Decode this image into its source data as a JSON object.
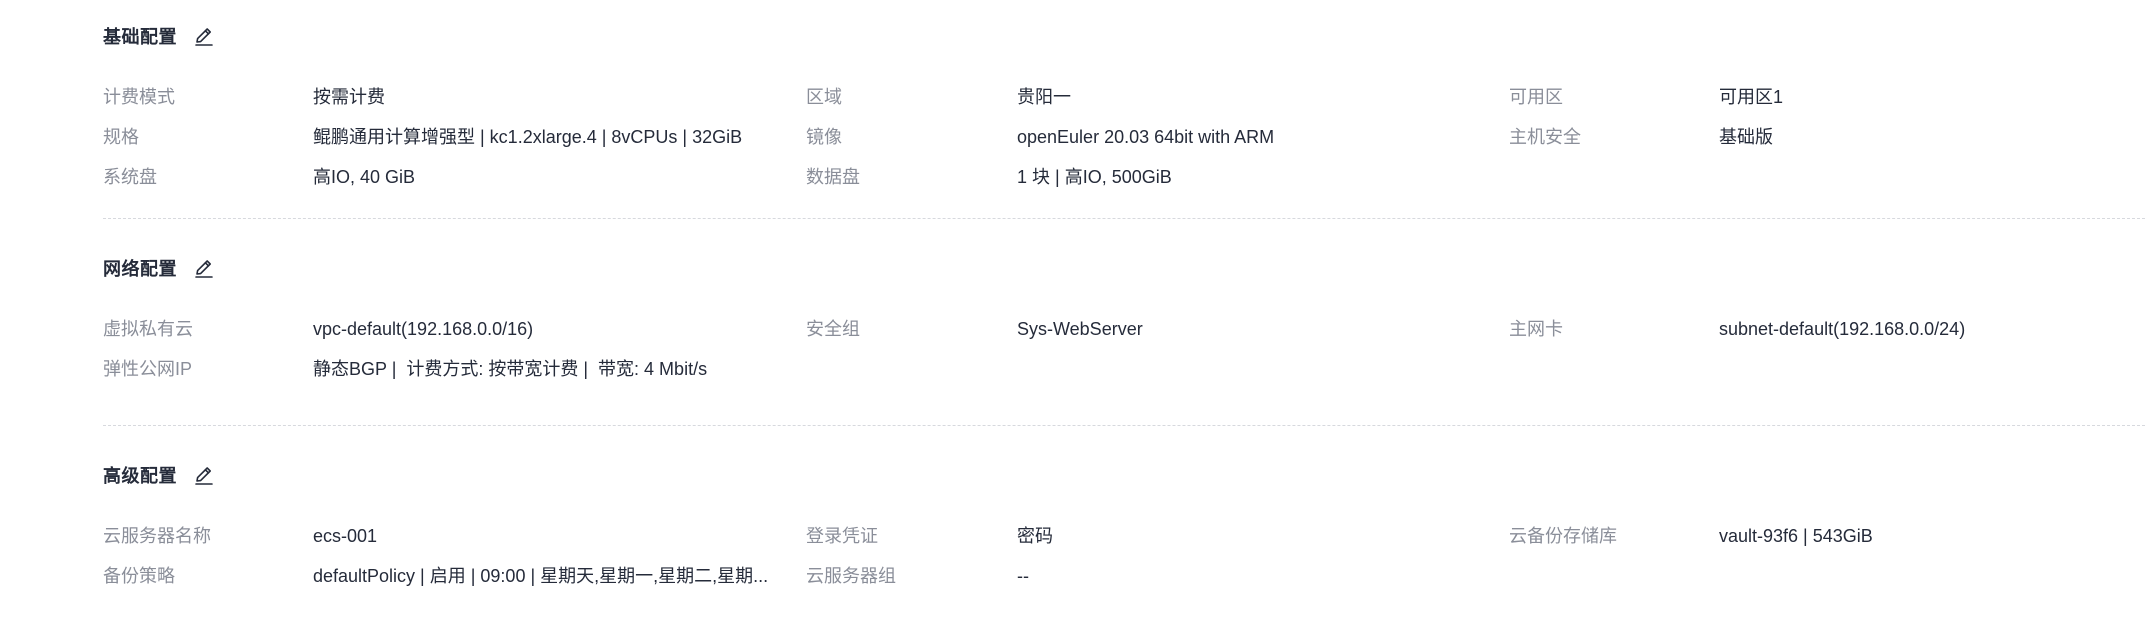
{
  "sections": [
    {
      "title": "基础配置",
      "rows": [
        [
          {
            "label": "计费模式",
            "value": "按需计费"
          },
          {
            "label": "区域",
            "value": "贵阳一"
          },
          {
            "label": "可用区",
            "value": "可用区1"
          }
        ],
        [
          {
            "label": "规格",
            "value": "鲲鹏通用计算增强型 | kc1.2xlarge.4 | 8vCPUs | 32GiB"
          },
          {
            "label": "镜像",
            "value": "openEuler 20.03 64bit with ARM"
          },
          {
            "label": "主机安全",
            "value": "基础版"
          }
        ],
        [
          {
            "label": "系统盘",
            "value": "高IO, 40 GiB"
          },
          {
            "label": "数据盘",
            "value": "1 块 | 高IO, 500GiB"
          }
        ]
      ]
    },
    {
      "title": "网络配置",
      "rows": [
        [
          {
            "label": "虚拟私有云",
            "value": "vpc-default(192.168.0.0/16)"
          },
          {
            "label": "安全组",
            "value": "Sys-WebServer"
          },
          {
            "label": "主网卡",
            "value": "subnet-default(192.168.0.0/24)"
          }
        ],
        [
          {
            "label": "弹性公网IP",
            "value": "静态BGP |  计费方式: 按带宽计费 |  带宽: 4 Mbit/s"
          }
        ]
      ]
    },
    {
      "title": "高级配置",
      "rows": [
        [
          {
            "label": "云服务器名称",
            "value": "ecs-001"
          },
          {
            "label": "登录凭证",
            "value": "密码"
          },
          {
            "label": "云备份存储库",
            "value": "vault-93f6 | 543GiB"
          }
        ],
        [
          {
            "label": "备份策略",
            "value": "defaultPolicy | 启用 | 09:00 | 星期天,星期一,星期二,星期..."
          },
          {
            "label": "云服务器组",
            "value": "--"
          }
        ]
      ]
    }
  ],
  "icons": {
    "edit": "edit-icon"
  },
  "colors": {
    "title": "#252b3a",
    "label": "#8a8e99",
    "value": "#252b3a",
    "divider": "#d7d9de"
  }
}
